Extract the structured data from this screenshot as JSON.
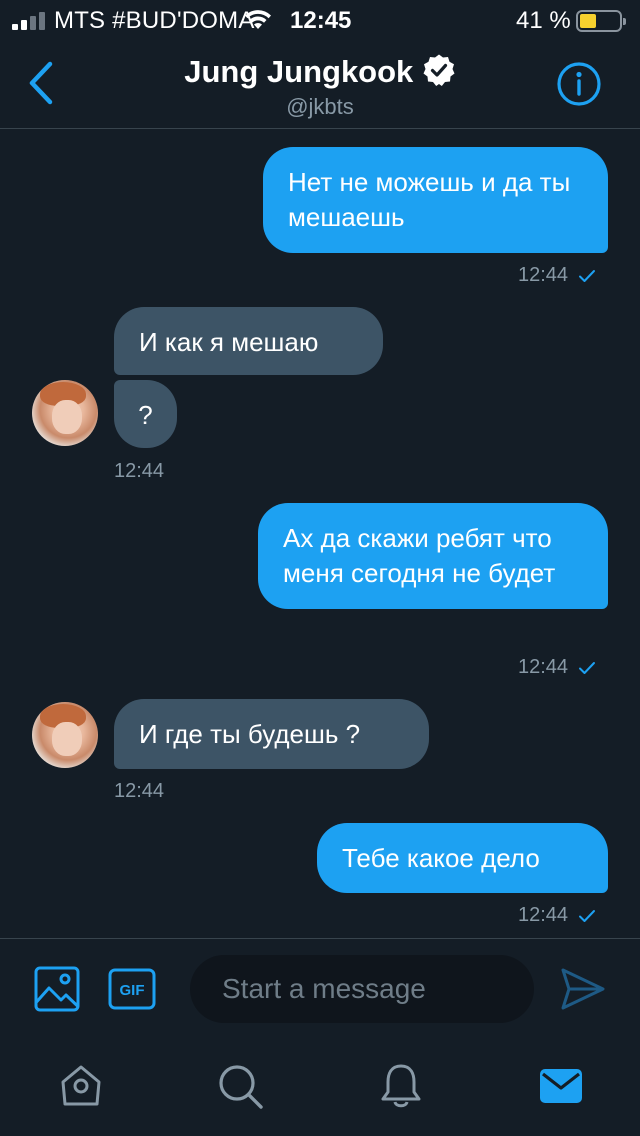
{
  "status": {
    "carrier": "MTS #BUD'DOMA",
    "time": "12:45",
    "battery": "41 %",
    "battery_level": 0.41,
    "battery_color": "#f7d12e"
  },
  "header": {
    "title": "Jung Jungkook",
    "handle": "@jkbts",
    "back_icon": "chevron-left-icon",
    "verified_icon": "verified-badge-icon",
    "info_icon": "info-icon"
  },
  "colors": {
    "background": "#141d26",
    "accent": "#1da1f2",
    "incoming_bubble": "#3d5466",
    "muted_text": "#8899a6"
  },
  "messages": [
    {
      "direction": "out",
      "text": "Нет не можешь и да ты мешаешь"
    },
    {
      "direction": "out_time",
      "time": "12:44",
      "read": true
    },
    {
      "direction": "in",
      "text": "И как я мешаю"
    },
    {
      "direction": "in",
      "text": "?"
    },
    {
      "direction": "in_time",
      "time": "12:44"
    },
    {
      "direction": "out",
      "text": "Ах да скажи ребят что меня сегодня не будет"
    },
    {
      "direction": "out_time",
      "time": "12:44",
      "read": true
    },
    {
      "direction": "in",
      "text": "И где ты будешь ?"
    },
    {
      "direction": "in_time",
      "time": "12:44"
    },
    {
      "direction": "out",
      "text": "Тебе какое дело"
    },
    {
      "direction": "out_time",
      "time": "12:44",
      "read": true
    }
  ],
  "composer": {
    "placeholder": "Start a message",
    "media_icon": "image-icon",
    "gif_label": "GIF",
    "send_icon": "send-icon"
  },
  "tabbar": {
    "items": [
      {
        "icon": "home-icon",
        "active": false
      },
      {
        "icon": "search-icon",
        "active": false
      },
      {
        "icon": "bell-icon",
        "active": false
      },
      {
        "icon": "mail-icon",
        "active": true
      }
    ]
  }
}
